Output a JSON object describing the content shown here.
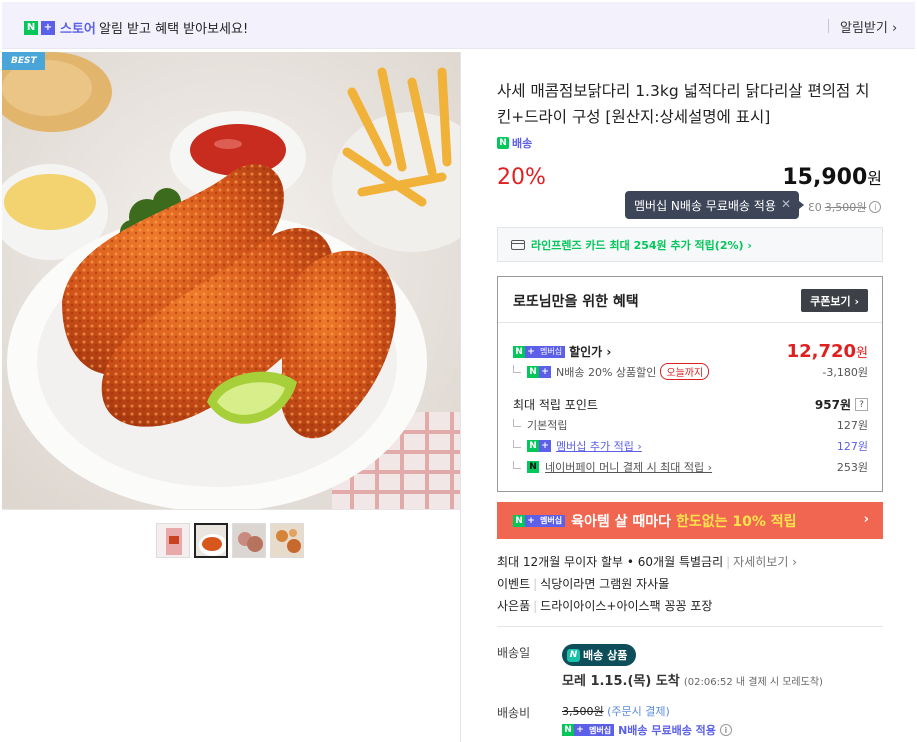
{
  "topbar": {
    "store_label": "스토어",
    "message": "알림 받고 혜택 받아보세요!",
    "alarm_button": "알림받기 ›"
  },
  "best_badge": "BEST",
  "product": {
    "title": "사세 매콤점보닭다리 1.3kg 넓적다리 닭다리살 편의점 치킨+드라이 구성 [원산지:상세설명에 표시]",
    "ship_badge": "배송",
    "discount_pct": "20%",
    "price": "15,900",
    "price_unit": "원",
    "tooltip": "멤버십 N배송 무료배송 적용",
    "tooltip_close": "✕",
    "ship_fee_prefix": "Ɛ0",
    "ship_fee_strike": "3,500원"
  },
  "card_promo": "라인프렌즈 카드 최대 254원 추가 적립(2%) ›",
  "benefit": {
    "title": "로또님만을 위한 혜택",
    "coupon_button": "쿠폰보기 ›",
    "membership_badge": "멤버십",
    "sale_label": "할인가 ›",
    "sale_price": "12,720",
    "sale_unit": "원",
    "discount_line": "N배송 20% 상품할인",
    "today_badge": "오늘까지",
    "discount_amount": "-3,180원",
    "points_title": "최대 적립 포인트",
    "points_value": "957원",
    "points_help": "?",
    "basic_label": "기본적립",
    "basic_value": "127원",
    "member_label": "멤버십 추가 적립 ›",
    "member_value": "127원",
    "pay_label": "네이버페이 머니 결제 시 최대 적립 ›",
    "pay_value": "253원"
  },
  "promo_banner": {
    "text": "육아템 살 때마다",
    "highlight": "한도없는 10% 적립",
    "arrow": "›"
  },
  "info": {
    "installment": "최대 12개월 무이자 할부 • 60개월 특별금리",
    "installment_link": "자세히보기 ›",
    "event_label": "이벤트",
    "event_text": "식당이라면 그램원 자사몰",
    "gift_label": "사은품",
    "gift_text": "드라이아이스+아이스팩 꽁꽁 포장"
  },
  "delivery": {
    "date_label": "배송일",
    "nship_badge": "배송 상품",
    "arrive_main": "모레 1.15.(목) 도착",
    "arrive_sub": "(02:06:52 내 결제 시 모레도착)",
    "fee_label": "배송비",
    "fee_strike": "3,500원",
    "fee_note": "(주문시 결제)",
    "free_text": "N배송 무료배송 적용"
  },
  "colors": {
    "naver_green": "#03c75a",
    "brand_purple": "#5c5fe8",
    "sale_red": "#e02020",
    "promo_orange": "#f16650"
  }
}
